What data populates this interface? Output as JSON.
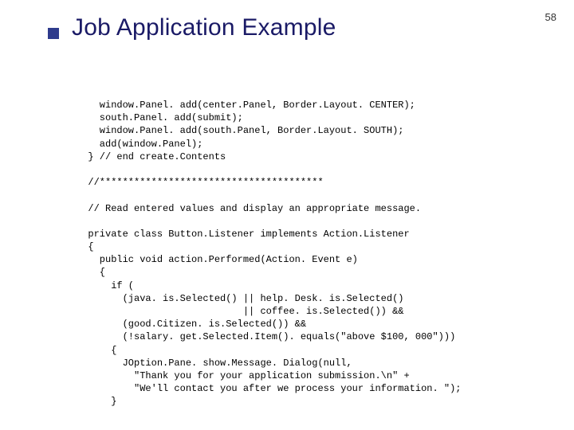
{
  "page_number": "58",
  "title": "Job Application Example",
  "code_lines": [
    "    window.Panel. add(center.Panel, Border.Layout. CENTER);",
    "    south.Panel. add(submit);",
    "    window.Panel. add(south.Panel, Border.Layout. SOUTH);",
    "    add(window.Panel);",
    "  } // end create.Contents",
    "",
    "  //***************************************",
    "",
    "  // Read entered values and display an appropriate message.",
    "",
    "  private class Button.Listener implements Action.Listener",
    "  {",
    "    public void action.Performed(Action. Event e)",
    "    {",
    "      if (",
    "        (java. is.Selected() || help. Desk. is.Selected()",
    "                             || coffee. is.Selected()) &&",
    "        (good.Citizen. is.Selected()) &&",
    "        (!salary. get.Selected.Item(). equals(\"above $100, 000\")))",
    "      {",
    "        JOption.Pane. show.Message. Dialog(null,",
    "          \"Thank you for your application submission.\\n\" +",
    "          \"We'll contact you after we process your information. \");",
    "      }"
  ]
}
